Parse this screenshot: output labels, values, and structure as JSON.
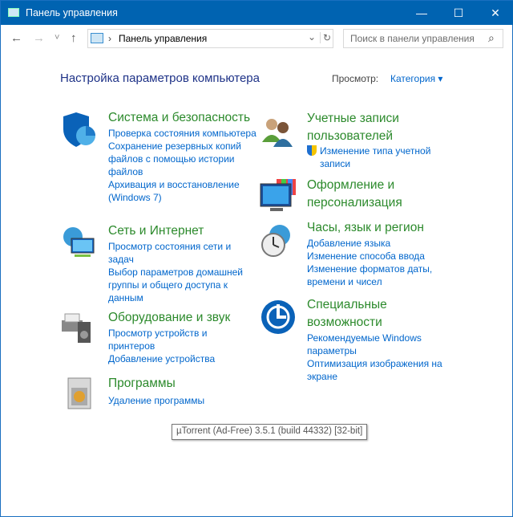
{
  "window": {
    "title": "Панель управления",
    "minimize": "—",
    "maximize": "☐",
    "close": "✕"
  },
  "nav": {
    "back": "←",
    "forward": "→",
    "recent": "˅",
    "up": "↑",
    "separator": "›",
    "path": "Панель управления",
    "dropdown": "⌄",
    "refresh": "↻"
  },
  "search": {
    "placeholder": "Поиск в панели управления",
    "icon": "⌕"
  },
  "main": {
    "title": "Настройка параметров компьютера",
    "view_label": "Просмотр:",
    "view_value": "Категория ▾"
  },
  "categories": [
    {
      "title": "Система и безопасность",
      "links": [
        "Проверка состояния компьютера",
        "Сохранение резервных копий файлов с помощью истории файлов",
        "Архивация и восстановление (Windows 7)"
      ]
    },
    {
      "title": "Сеть и Интернет",
      "links": [
        "Просмотр состояния сети и задач",
        "Выбор параметров домашней группы и общего доступа к данным"
      ]
    },
    {
      "title": "Оборудование и звук",
      "links": [
        "Просмотр устройств и принтеров",
        "Добавление устройства"
      ]
    },
    {
      "title": "Программы",
      "links": [
        "Удаление программы"
      ]
    },
    {
      "title": "Учетные записи пользователей",
      "links": [
        "Изменение типа учетной записи"
      ]
    },
    {
      "title": "Оформление и персонализация",
      "links": []
    },
    {
      "title": "Часы, язык и регион",
      "links": [
        "Добавление языка",
        "Изменение способа ввода",
        "Изменение форматов даты, времени и чисел"
      ]
    },
    {
      "title": "Специальные возможности",
      "links": [
        "Рекомендуемые Windows параметры",
        "Оптимизация изображения на экране"
      ]
    }
  ],
  "tooltip": "µTorrent (Ad-Free) 3.5.1  (build 44332) [32-bit]"
}
